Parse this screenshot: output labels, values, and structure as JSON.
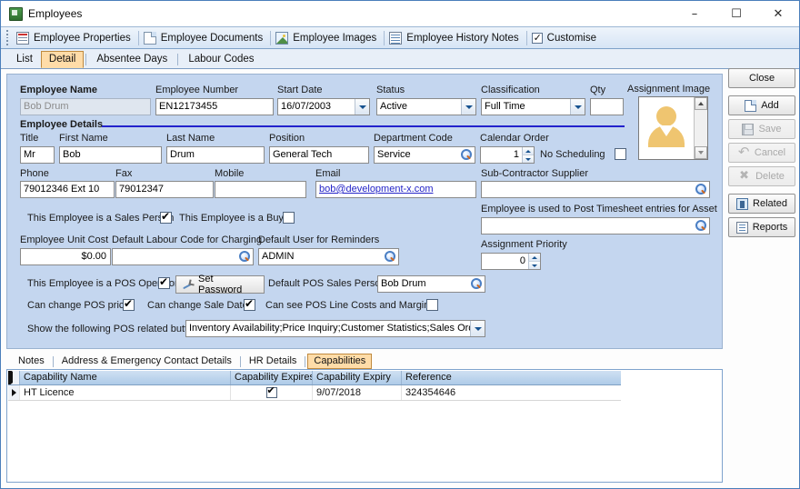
{
  "window": {
    "title": "Employees",
    "icon": "app-icon",
    "minimize": "–",
    "maximize": "☐",
    "close": "✕"
  },
  "ribbon": {
    "items": [
      {
        "label": "Employee Properties",
        "icon": "document-properties-icon"
      },
      {
        "label": "Employee Documents",
        "icon": "document-icon"
      },
      {
        "label": "Employee Images",
        "icon": "image-icon"
      },
      {
        "label": "Employee History Notes",
        "icon": "notes-icon"
      },
      {
        "label": "Customise",
        "icon": "checkbox-icon"
      }
    ]
  },
  "top_tabs": {
    "items": [
      {
        "label": "List",
        "selected": false
      },
      {
        "label": "Detail",
        "selected": true
      },
      {
        "label": "Absentee Days",
        "selected": false
      },
      {
        "label": "Labour Codes",
        "selected": false
      }
    ]
  },
  "form": {
    "employee_name": {
      "label": "Employee Name",
      "value": "Bob Drum",
      "readonly": true
    },
    "employee_number": {
      "label": "Employee Number",
      "value": "EN12173455"
    },
    "start_date": {
      "label": "Start Date",
      "value": "16/07/2003"
    },
    "status": {
      "label": "Status",
      "value": "Active"
    },
    "classification": {
      "label": "Classification",
      "value": "Full Time"
    },
    "qty": {
      "label": "Qty",
      "value": ""
    },
    "assignment_image": {
      "label": "Assignment Image",
      "icon": "person-avatar-icon"
    },
    "details_group": {
      "label": "Employee Details"
    },
    "title_field": {
      "label": "Title",
      "value": "Mr"
    },
    "first_name": {
      "label": "First Name",
      "value": "Bob"
    },
    "last_name": {
      "label": "Last Name",
      "value": "Drum"
    },
    "position": {
      "label": "Position",
      "value": "General Tech"
    },
    "department_code": {
      "label": "Department Code",
      "value": "Service"
    },
    "calendar_order": {
      "label": "Calendar Order",
      "value": "1"
    },
    "no_scheduling": {
      "label": "No Scheduling",
      "checked": false
    },
    "phone": {
      "label": "Phone",
      "value": "79012346 Ext 10"
    },
    "fax": {
      "label": "Fax",
      "value": "79012347"
    },
    "mobile": {
      "label": "Mobile",
      "value": ""
    },
    "email": {
      "label": "Email",
      "value": "bob@development-x.com"
    },
    "sub_contractor_supplier": {
      "label": "Sub-Contractor Supplier",
      "value": ""
    },
    "timesheet_asset": {
      "label": "Employee is used to Post Timesheet entries for Asset",
      "value": ""
    },
    "assignment_priority": {
      "label": "Assignment Priority",
      "value": "0"
    },
    "is_sales_person": {
      "label": "This Employee is a Sales Person",
      "checked": true
    },
    "is_buyer": {
      "label": "This Employee is a Buyer",
      "checked": false
    },
    "employee_unit_cost": {
      "label": "Employee Unit Cost",
      "value": "$0.00"
    },
    "default_labour_code": {
      "label": "Default Labour Code for Charging",
      "value": ""
    },
    "default_user_reminders": {
      "label": "Default User for Reminders",
      "value": "ADMIN"
    },
    "is_pos_operator": {
      "label": "This Employee is a POS Operator",
      "checked": true
    },
    "set_password": {
      "label": "Set Password",
      "icon": "pen-icon"
    },
    "default_pos_sales_person": {
      "label": "Default POS Sales Person",
      "value": "Bob Drum"
    },
    "can_change_pos_prices": {
      "label": "Can change POS prices",
      "checked": true
    },
    "can_change_sale_date": {
      "label": "Can change Sale Date",
      "checked": true
    },
    "can_see_pos_costs": {
      "label": "Can see POS Line Costs and Margins",
      "checked": false
    },
    "pos_buttons": {
      "label": "Show the following POS related buttons",
      "value": "Inventory Availability;Price Inquiry;Customer Statistics;Sales Orders;Inv"
    }
  },
  "sidebar": {
    "buttons": [
      {
        "label": "Close",
        "icon": "",
        "disabled": false
      },
      {
        "label": "Add",
        "icon": "add-icon",
        "disabled": false
      },
      {
        "label": "Save",
        "icon": "save-icon",
        "disabled": true
      },
      {
        "label": "Cancel",
        "icon": "cancel-icon",
        "disabled": true
      },
      {
        "label": "Delete",
        "icon": "delete-icon",
        "disabled": true
      },
      {
        "label": "Related",
        "icon": "related-icon",
        "disabled": false
      },
      {
        "label": "Reports",
        "icon": "reports-icon",
        "disabled": false
      }
    ]
  },
  "bottom_tabs": {
    "items": [
      {
        "label": "Notes",
        "selected": false
      },
      {
        "label": "Address & Emergency Contact Details",
        "selected": false
      },
      {
        "label": "HR Details",
        "selected": false
      },
      {
        "label": "Capabilities",
        "selected": true
      }
    ]
  },
  "grid": {
    "columns": [
      "Capability Name",
      "Capability Expires",
      "Capability Expiry",
      "Reference"
    ],
    "rows": [
      {
        "selected": true,
        "capability_name": "HT Licence",
        "capability_expires": true,
        "capability_expiry": "9/07/2018",
        "reference": "324354646"
      }
    ]
  }
}
